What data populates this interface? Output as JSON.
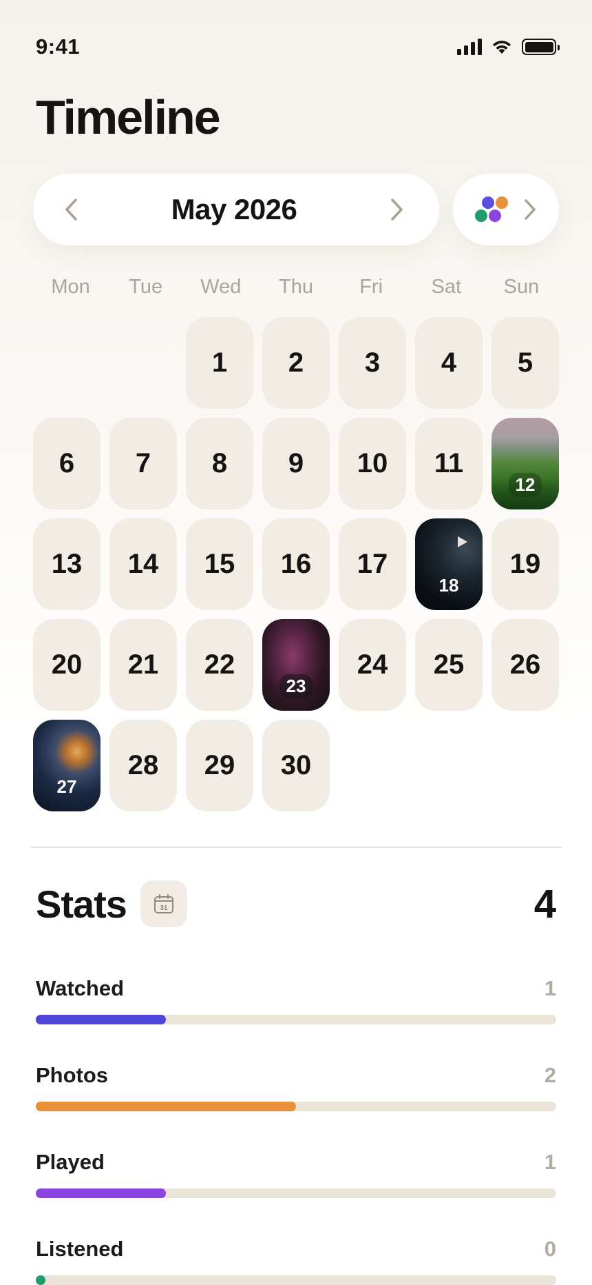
{
  "status": {
    "time": "9:41"
  },
  "header": {
    "title": "Timeline"
  },
  "calendar": {
    "month": "May 2026",
    "weekdays": [
      "Mon",
      "Tue",
      "Wed",
      "Thu",
      "Fri",
      "Sat",
      "Sun"
    ],
    "days": [
      "1",
      "2",
      "3",
      "4",
      "5",
      "6",
      "7",
      "8",
      "9",
      "10",
      "11",
      "12",
      "13",
      "14",
      "15",
      "16",
      "17",
      "18",
      "19",
      "20",
      "21",
      "22",
      "23",
      "24",
      "25",
      "26",
      "27",
      "28",
      "29",
      "30"
    ]
  },
  "filter": {
    "dot_colors": [
      "#5b4fe0",
      "#e8913a",
      "#1f9b6e",
      "#8c44e0"
    ]
  },
  "stats": {
    "title": "Stats",
    "calendar_icon_day": "31",
    "total": "4",
    "items": [
      {
        "label": "Watched",
        "count": "1",
        "fraction": 0.25,
        "color": "#4e46d9"
      },
      {
        "label": "Photos",
        "count": "2",
        "fraction": 0.5,
        "color": "#e8913a"
      },
      {
        "label": "Played",
        "count": "1",
        "fraction": 0.25,
        "color": "#8c44e0"
      },
      {
        "label": "Listened",
        "count": "0",
        "fraction": 0.0,
        "color": "#1f9b6e"
      }
    ]
  }
}
